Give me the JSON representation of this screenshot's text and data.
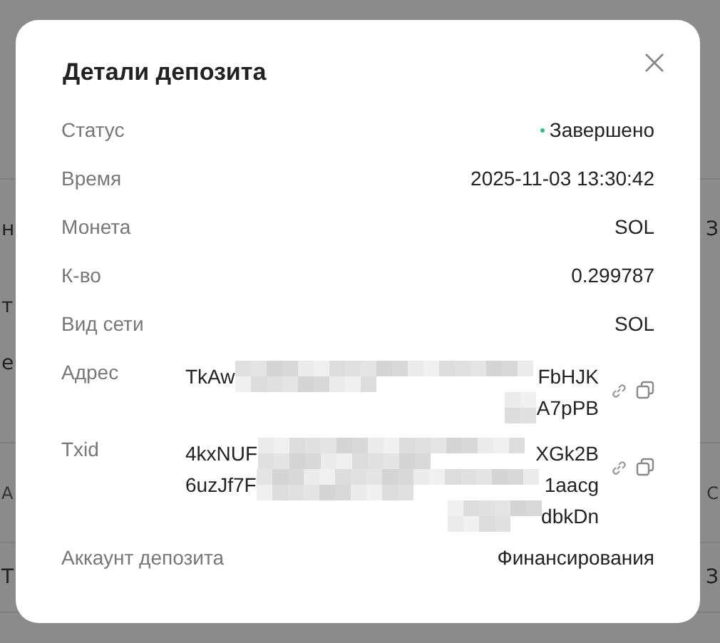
{
  "backdrop": {
    "rows": [
      {
        "left": "н",
        "right": "З"
      },
      {
        "left": "т"
      },
      {
        "left": "е"
      },
      {
        "left": "А",
        "right": "С"
      },
      {
        "left": "Т",
        "right": "З"
      }
    ]
  },
  "dialog": {
    "title": "Детали депозита",
    "rows": [
      {
        "kind": "status",
        "label": "Статус",
        "value": "Завершено"
      },
      {
        "kind": "text",
        "label": "Время",
        "value": "2025-11-03 13:30:42"
      },
      {
        "kind": "text",
        "label": "Монета",
        "value": "SOL"
      },
      {
        "kind": "text",
        "label": "К-во",
        "value": "0.299787"
      },
      {
        "kind": "text",
        "label": "Вид сети",
        "value": "SOL"
      },
      {
        "kind": "hash",
        "label": "Адрес",
        "lines": [
          {
            "start": "TkAw",
            "end": "FbHJK"
          },
          {
            "end": "A7pPB"
          }
        ]
      },
      {
        "kind": "hash",
        "label": "Txid",
        "lines": [
          {
            "start": "4kxNUF",
            "end": "XGk2B"
          },
          {
            "start": "6uzJf7F",
            "end": "1aacg"
          },
          {
            "end": "dbkDn"
          }
        ]
      },
      {
        "kind": "text",
        "label": "Аккаунт депозита",
        "value": "Финансирования"
      }
    ]
  }
}
